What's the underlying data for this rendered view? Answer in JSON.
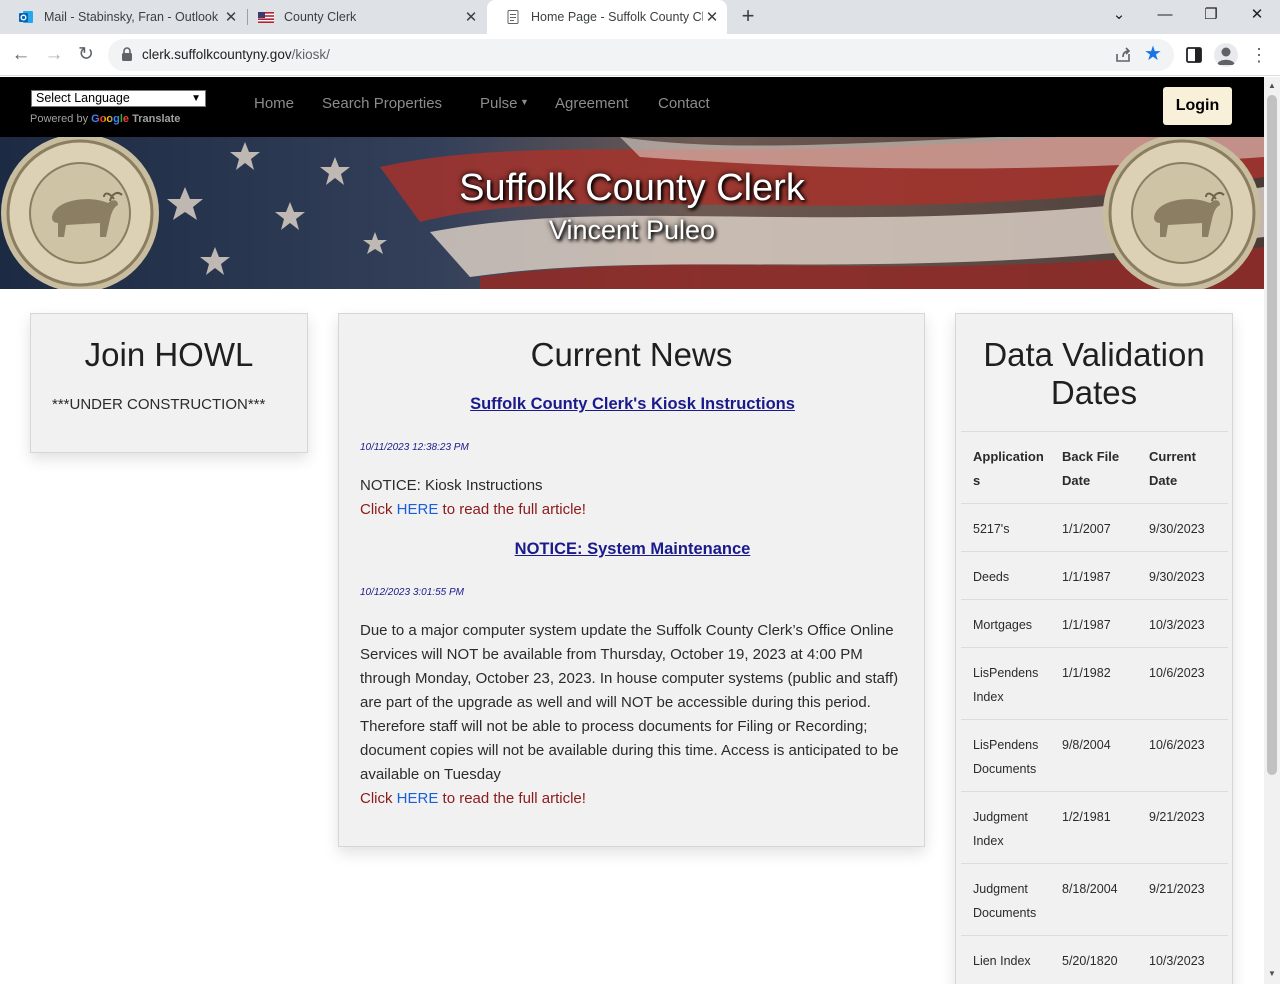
{
  "browser": {
    "tabs": [
      {
        "title": "Mail - Stabinsky, Fran - Outlook",
        "icon": "outlook-icon"
      },
      {
        "title": "County Clerk",
        "icon": "us-flag-icon"
      },
      {
        "title": "Home Page - Suffolk County Cle",
        "icon": "page-icon"
      }
    ],
    "url_host": "clerk.suffolkcountyny.gov",
    "url_path": "/kiosk/"
  },
  "nav": {
    "language_select": "Select Language",
    "powered_by": "Powered by",
    "google": "Google",
    "translate": "Translate",
    "menu": [
      "Home",
      "Search Properties",
      "Pulse",
      "Agreement",
      "Contact"
    ],
    "login": "Login"
  },
  "banner": {
    "title": "Suffolk County Clerk",
    "subtitle": "Vincent Puleo"
  },
  "howl": {
    "title": "Join HOWL",
    "text": "***UNDER CONSTRUCTION***"
  },
  "news": {
    "title": "Current News",
    "click_prefix": "Click ",
    "here": "HERE",
    "click_suffix": " to read the full article!",
    "articles": [
      {
        "title": "Suffolk County Clerk's Kiosk Instructions",
        "date": "10/11/2023 12:38:23 PM",
        "body": "NOTICE: Kiosk Instructions"
      },
      {
        "title": "NOTICE: System Maintenance",
        "date": "10/12/2023 3:01:55 PM",
        "body": "Due to a major computer system update the Suffolk County Clerk’s Office Online Services will NOT be available from Thursday, October 19, 2023 at 4:00 PM through Monday, October 23, 2023. In house computer systems (public and staff) are part of the upgrade as well and will NOT be accessible during this period. Therefore staff will not be able to process documents for Filing or Recording; document copies will not be available during this time. Access is anticipated to be available on Tuesday"
      }
    ]
  },
  "validation": {
    "title": "Data Validation Dates",
    "headers": [
      "Applications",
      "Back File Date",
      "Current Date"
    ],
    "rows": [
      [
        "5217's",
        "1/1/2007",
        "9/30/2023"
      ],
      [
        "Deeds",
        "1/1/1987",
        "9/30/2023"
      ],
      [
        "Mortgages",
        "1/1/1987",
        "10/3/2023"
      ],
      [
        "LisPendens Index",
        "1/1/1982",
        "10/6/2023"
      ],
      [
        "LisPendens Documents",
        "9/8/2004",
        "10/6/2023"
      ],
      [
        "Judgment Index",
        "1/2/1981",
        "9/21/2023"
      ],
      [
        "Judgment Documents",
        "8/18/2004",
        "9/21/2023"
      ],
      [
        "Lien Index",
        "5/20/1820",
        "10/3/2023"
      ]
    ]
  },
  "colors": {
    "nav_bg": "#000000",
    "login_bg": "#f9f0d9",
    "card_bg": "#f1f1f1",
    "link_title": "#1a1a8c",
    "click_text": "#8b1a1a",
    "here_link": "#1a5fd6"
  }
}
